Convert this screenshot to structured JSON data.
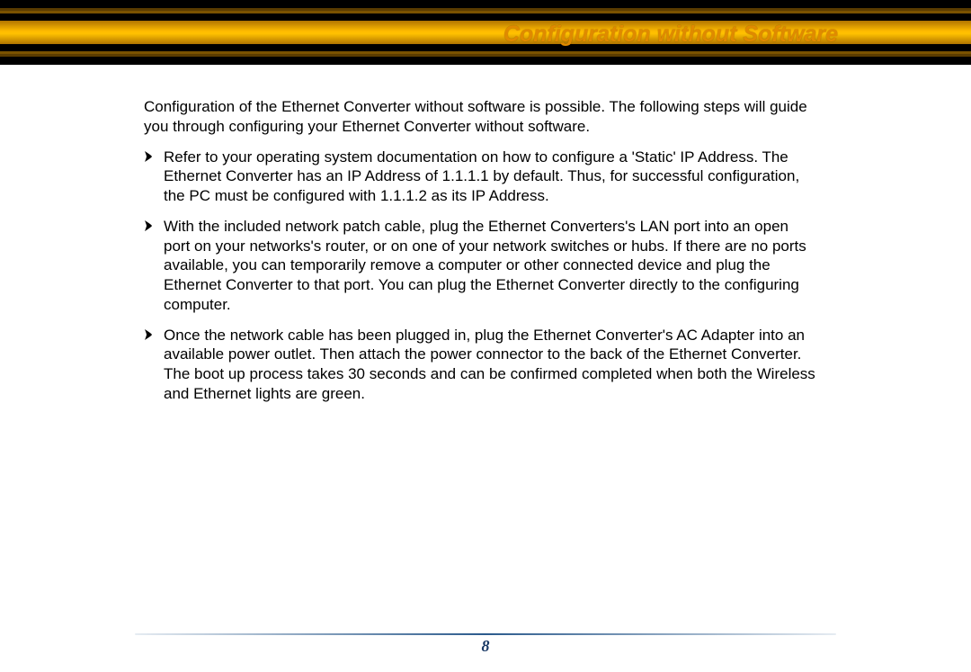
{
  "header": {
    "title": "Configuration without Software"
  },
  "body": {
    "intro": "Configuration of the Ethernet Converter without software is possible.  The following steps will guide you through configuring your Ethernet Converter without software.",
    "steps": [
      "Refer to your operating system documentation on how to configure a 'Static' IP Address.  The Ethernet Converter has an IP Address of 1.1.1.1 by default.  Thus, for successful configuration, the PC must be configured with 1.1.1.2 as its IP Address.",
      "With the included network patch cable, plug the Ethernet Converters's LAN port into an open port on your networks's router, or on one of your network switches or hubs.  If there are no ports available, you can temporarily remove a computer or other connected device and plug the Ethernet Converter to that port.  You can plug the Ethernet Converter directly to the configuring computer.",
      "Once the network cable has been plugged in, plug the Ethernet Converter's AC Adapter into an available power outlet.  Then attach the power connector to the back of the Ethernet Converter.  The boot up process takes 30 seconds and can be confirmed completed when both the Wireless and Ethernet lights are green."
    ]
  },
  "footer": {
    "page_number": "8"
  },
  "icons": {
    "bullet": "triangle-bullet-icon"
  },
  "colors": {
    "title": "#e08a00",
    "footer_accent": "#2b5a8c"
  }
}
